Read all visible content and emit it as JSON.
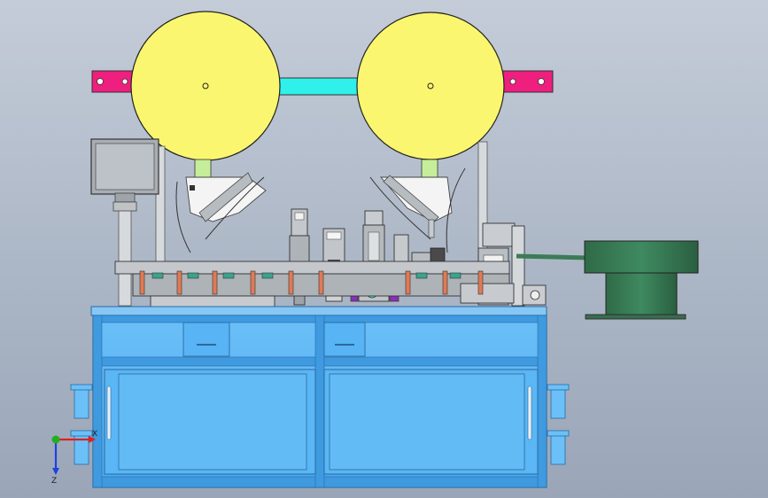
{
  "colors": {
    "background_top": "#c4ccd8",
    "background_bottom": "#9aa6b8",
    "reel": "#fbf66f",
    "bracket": "#ee1f7e",
    "connector_bar": "#2ff0ea",
    "cabinet": "#58b4f4",
    "cabinet_frame": "#2f8fd8",
    "feeder": "#3b7c56",
    "mechanism_grey": "#b8bcc0",
    "orange_parts": "#e07a55",
    "green_parts": "#3aa38c",
    "purple_part": "#8a2fb8"
  },
  "triad": {
    "labels": {
      "x": "X",
      "y": "Y",
      "z": "Z"
    },
    "colors": {
      "x": "#e02020",
      "y": "#20b020",
      "z": "#2040e0"
    }
  },
  "parts": {
    "reels": [
      "left-reel",
      "right-reel"
    ],
    "top_assembly": [
      "left-bracket",
      "right-bracket",
      "connector-bar"
    ],
    "work_area": [
      "control-screen",
      "conveyor-rail",
      "punch-station",
      "pick-station",
      "press-station",
      "feed-station"
    ],
    "feeder": [
      "vibratory-bowl-feeder",
      "feeder-track"
    ],
    "base": [
      "cabinet-frame",
      "left-drawer",
      "right-drawer",
      "left-cabinet-door",
      "right-cabinet-door",
      "leveling-feet"
    ]
  }
}
